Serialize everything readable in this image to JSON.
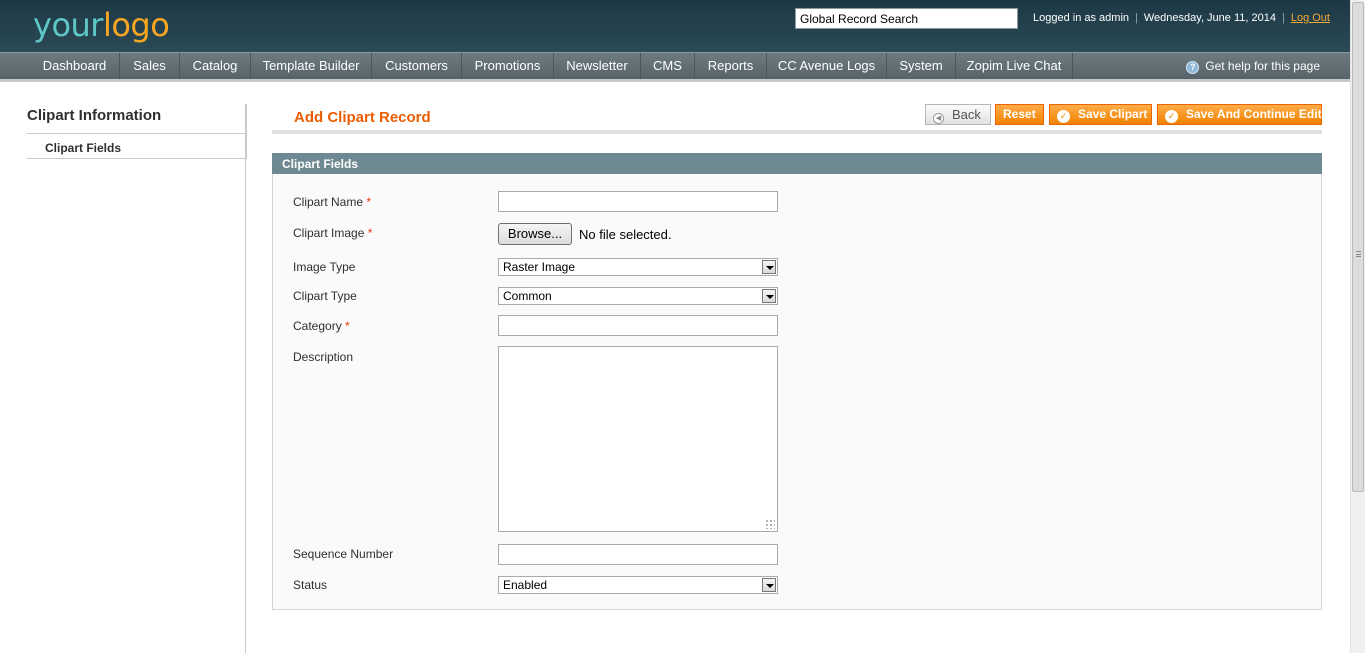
{
  "header": {
    "logo_part1": "your",
    "logo_part2": "logo",
    "search_value": "Global Record Search",
    "logged_in": "Logged in as admin",
    "date": "Wednesday, June 11, 2014",
    "logout": "Log Out"
  },
  "nav": {
    "items": [
      {
        "label": "Dashboard"
      },
      {
        "label": "Sales"
      },
      {
        "label": "Catalog"
      },
      {
        "label": "Template Builder"
      },
      {
        "label": "Customers"
      },
      {
        "label": "Promotions"
      },
      {
        "label": "Newsletter"
      },
      {
        "label": "CMS"
      },
      {
        "label": "Reports"
      },
      {
        "label": "CC Avenue Logs"
      },
      {
        "label": "System"
      },
      {
        "label": "Zopim Live Chat"
      }
    ],
    "help": "Get help for this page"
  },
  "sidebar": {
    "title": "Clipart Information",
    "items": [
      {
        "label": "Clipart Fields"
      }
    ]
  },
  "page": {
    "title": "Add Clipart Record",
    "buttons": {
      "back": "Back",
      "reset": "Reset",
      "save": "Save Clipart",
      "save_continue": "Save And Continue Edit"
    }
  },
  "form": {
    "section_title": "Clipart Fields",
    "required_mark": "*",
    "fields": {
      "clipart_name": {
        "label": "Clipart Name",
        "value": ""
      },
      "clipart_image": {
        "label": "Clipart Image",
        "browse": "Browse...",
        "no_file": "No file selected."
      },
      "image_type": {
        "label": "Image Type",
        "value": "Raster Image"
      },
      "clipart_type": {
        "label": "Clipart Type",
        "value": "Common"
      },
      "category": {
        "label": "Category",
        "value": ""
      },
      "description": {
        "label": "Description",
        "value": ""
      },
      "sequence_number": {
        "label": "Sequence Number",
        "value": ""
      },
      "status": {
        "label": "Status",
        "value": "Enabled"
      }
    }
  },
  "colors": {
    "accent_orange": "#eb5e00",
    "button_orange": "#f18200",
    "header_dark": "#1d3844",
    "nav_gray": "#6d7a7f",
    "section_head": "#6f8992"
  }
}
